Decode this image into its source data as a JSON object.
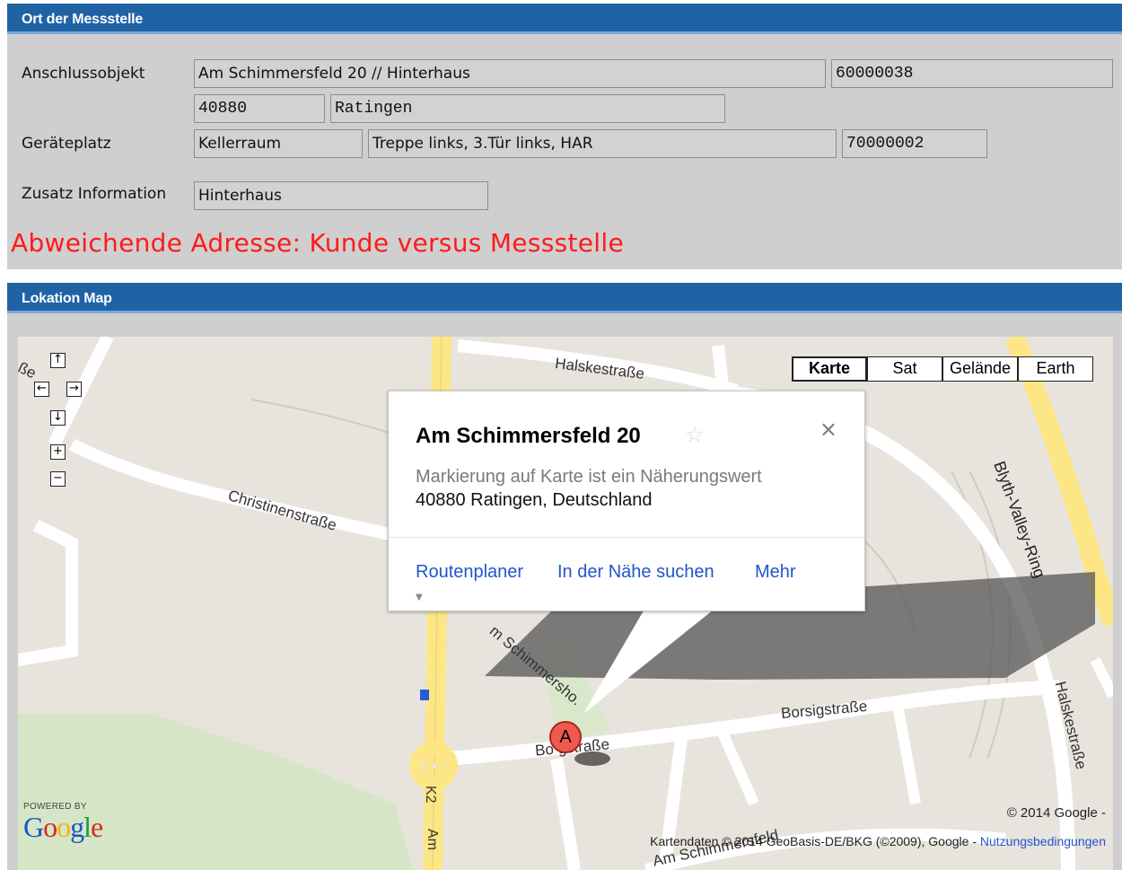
{
  "section1": {
    "title": "Ort der Messstelle",
    "labels": {
      "anschluss": "Anschlussobjekt",
      "geraete": "Geräteplatz",
      "zusatz": "Zusatz Information"
    },
    "fields": {
      "street": "Am Schimmersfeld 20 // Hinterhaus",
      "object_no": "60000038",
      "zip": "40880",
      "city": "Ratingen",
      "room": "Kellerraum",
      "location_desc": "Treppe links, 3.Tür links, HAR",
      "device_no": "70000002",
      "zusatz_value": "Hinterhaus"
    },
    "warning": "Abweichende Adresse: Kunde versus Messstelle",
    "warning_color": "#ff1a1a"
  },
  "section2": {
    "title": "Lokation Map",
    "map_types": [
      "Karte",
      "Sat",
      "Gelände",
      "Earth"
    ],
    "active_map_type": "Karte",
    "nav": {
      "up": "↑",
      "left": "←",
      "right": "→",
      "down": "↓",
      "zoom_in": "+",
      "zoom_out": "−"
    },
    "popup": {
      "title": "Am Schimmersfeld 20",
      "star": "☆",
      "close": "×",
      "subtitle": "Markierung auf Karte ist ein Näherungswert",
      "address": "40880 Ratingen, Deutschland",
      "links": [
        "Routenplaner",
        "In der Nähe suchen",
        "Mehr"
      ],
      "caret": "▼"
    },
    "streets": {
      "halske_top": "Halskestraße",
      "christinen": "Christinenstraße",
      "blyth": "Blyth-Valley-Ring",
      "schimmers": "m Schimmersho.",
      "borsig_right": "Borsigstraße",
      "borsig_left": "Bo  gstraße",
      "halske_right": "Halskestraße",
      "schimmersfeld_bottom": "Am Schimmersfeld",
      "k2": "K2",
      "am": "Am",
      "partial_left": "ße"
    },
    "marker_label": "A",
    "powered_by": "POWERED BY",
    "google_letters": [
      "G",
      "o",
      "o",
      "g",
      "l",
      "e"
    ],
    "google_colors": [
      "#1a55c9",
      "#d62d20",
      "#f2b50f",
      "#1a55c9",
      "#1e9c3f",
      "#d62d20"
    ],
    "copyright_top": "© 2014 Google -",
    "copyright_bottom": "Kartendaten © 2014 GeoBasis-DE/BKG (©2009), Google -",
    "terms_link": "Nutzungsbedingungen",
    "colors": {
      "header_bg": "#1f63a5",
      "panel_bg": "#cfcfcf",
      "map_bg": "#e8e4dd",
      "road_yellow": "#fce686",
      "park_green": "#d4e4c4",
      "link_blue": "#2255cc"
    }
  }
}
